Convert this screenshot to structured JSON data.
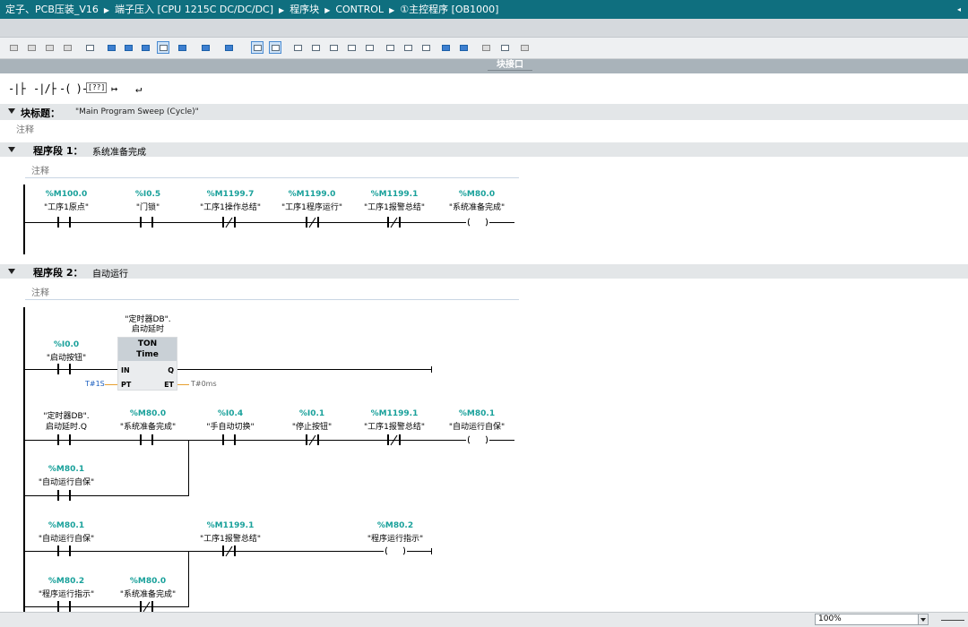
{
  "breadcrumb": {
    "parts": [
      "定子、PCB压装_V16",
      "端子压入 [CPU 1215C DC/DC/DC]",
      "程序块",
      "CONTROL",
      "①主控程序 [OB1000]"
    ]
  },
  "block_tab": {
    "label": "块接口"
  },
  "ladder_palette": [
    "-|├",
    "-|/├",
    "-( )-",
    "[??]",
    "↦",
    "↵"
  ],
  "block_title": {
    "label": "块标题：",
    "value": "\"Main Program Sweep (Cycle)\"",
    "comment": "注释"
  },
  "networks": [
    {
      "label": "程序段 1：",
      "title": "系统准备完成",
      "comment": "注释",
      "contacts": [
        {
          "addr": "%M100.0",
          "name": "\"工序1原点\""
        },
        {
          "addr": "%I0.5",
          "name": "\"门锁\""
        },
        {
          "addr": "%M1199.7",
          "name": "\"工序1操作总结\""
        },
        {
          "addr": "%M1199.0",
          "name": "\"工序1程序运行\""
        },
        {
          "addr": "%M1199.1",
          "name": "\"工序1报警总结\""
        },
        {
          "addr": "%M80.0",
          "name": "\"系统准备完成\""
        }
      ]
    },
    {
      "label": "程序段 2：",
      "title": "自动运行",
      "comment": "注释",
      "timer": {
        "db": "\"定时器DB\".",
        "db2": "启动延时",
        "type": "TON",
        "sub": "Time",
        "pin_in": "IN",
        "pin_q": "Q",
        "pin_pt": "PT",
        "pin_et": "ET",
        "pt_value": "T#1S",
        "et_value": "T#0ms",
        "input_addr": "%I0.0",
        "input_name": "\"启动按钮\""
      },
      "row2": [
        {
          "addr": "\"定时器DB\".",
          "name": "启动延时.Q"
        },
        {
          "addr": "%M80.0",
          "name": "\"系统准备完成\""
        },
        {
          "addr": "%I0.4",
          "name": "\"手自动切换\""
        },
        {
          "addr": "%I0.1",
          "name": "\"停止按钮\""
        },
        {
          "addr": "%M1199.1",
          "name": "\"工序1报警总结\""
        },
        {
          "addr": "%M80.1",
          "name": "\"自动运行自保\""
        }
      ],
      "branch2": {
        "addr": "%M80.1",
        "name": "\"自动运行自保\""
      },
      "row3": [
        {
          "addr": "%M80.1",
          "name": "\"自动运行自保\""
        },
        {
          "addr": "%M1199.1",
          "name": "\"工序1报警总结\""
        },
        {
          "addr": "%M80.2",
          "name": "\"程序运行指示\""
        }
      ],
      "branch3": [
        {
          "addr": "%M80.2",
          "name": "\"程序运行指示\""
        },
        {
          "addr": "%M80.0",
          "name": "\"系统准备完成\""
        }
      ]
    }
  ],
  "status": {
    "zoom": "100%"
  },
  "colors": {
    "titlebar": "#0f6f7f",
    "operand": "#1aa19b",
    "timer_value": "#e8a030"
  }
}
